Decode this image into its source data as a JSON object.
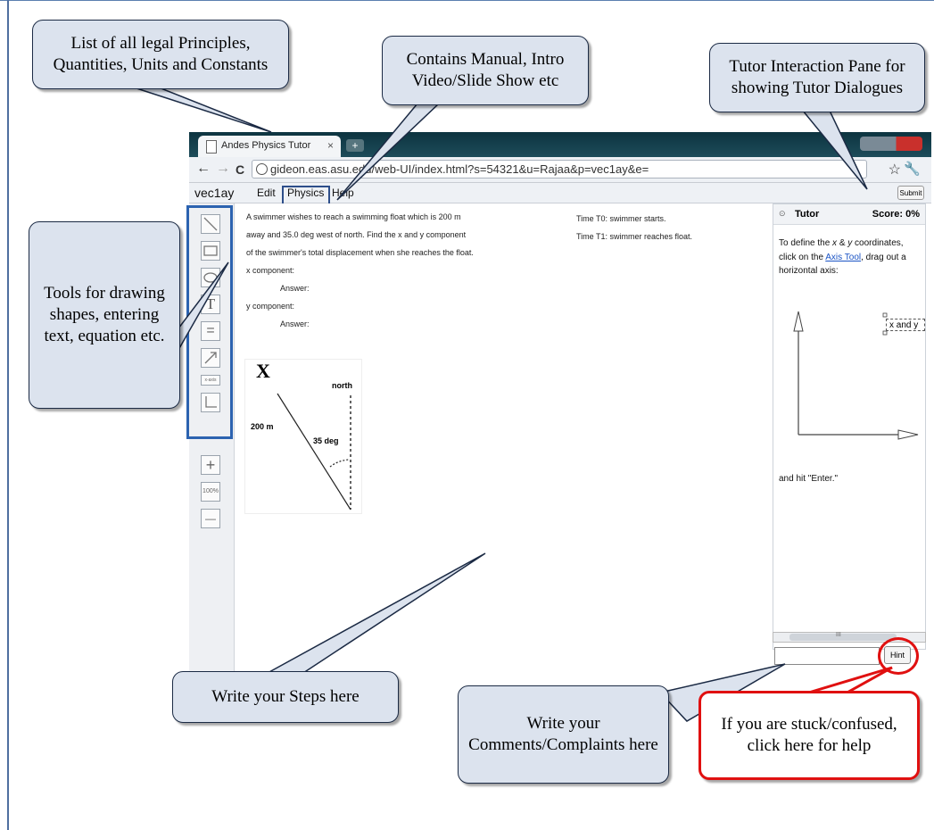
{
  "callouts": {
    "principles": "List of all legal Principles, Quantities, Units and Constants",
    "manual": "Contains Manual, Intro Video/Slide Show etc",
    "tutor_pane": "Tutor Interaction Pane for showing Tutor Dialogues",
    "tools": "Tools for drawing shapes, entering text, equation etc.",
    "steps": "Write your Steps here",
    "comments": "Write your Comments/Complaints here",
    "hint": "If you are stuck/confused, click here for help"
  },
  "browser": {
    "tab_title": "Andes Physics Tutor",
    "tab_close": "×",
    "new_tab": "+",
    "url": "gideon.eas.asu.edu/web-UI/index.html?s=54321&u=Rajaa&p=vec1ay&e=",
    "back_icon": "←",
    "forward_icon": "→",
    "reload_icon": "C",
    "star_icon": "☆",
    "wrench_icon": "🔧"
  },
  "menubar": {
    "problem": "vec1ay",
    "items": [
      "Edit",
      "Physics",
      "Help"
    ],
    "submit_label": "Submit"
  },
  "tools": {
    "items": [
      "line-tool",
      "rectangle-tool",
      "ellipse-tool",
      "text-tool",
      "equation-tool",
      "vector-tool",
      "axes-label-tool",
      "axes-tool"
    ],
    "text_glyph": "T",
    "equation_glyph": "=",
    "axes_label": "x-axis",
    "zoom_in": "+",
    "zoom_level": "100%",
    "zoom_out": "—"
  },
  "problem": {
    "lines": [
      "A swimmer wishes to reach a swimming float which is 200 m",
      "away and 35.0 deg west of north. Find the x and y component",
      "of the swimmer's total displacement when she reaches the float."
    ],
    "x_component": "x component:",
    "y_component": "y component:",
    "answer": "Answer:",
    "time_t0": "Time T0: swimmer starts.",
    "time_t1": "Time T1: swimmer reaches float.",
    "figure": {
      "x_mark": "X",
      "north": "north",
      "distance": "200 m",
      "angle": "35 deg"
    }
  },
  "tutor": {
    "title": "Tutor",
    "score": "Score: 0%",
    "msg_pre": "To define the ",
    "msg_x": "x",
    "msg_amp": " & ",
    "msg_y": "y",
    "msg_mid": " coordinates, click on the ",
    "link": "Axis Tool",
    "msg_post": ", drag out a horizontal axis:",
    "axis_label": "x and y",
    "enter_msg": "and hit \"Enter.\"",
    "scroll_grip": "III",
    "hint_label": "Hint"
  },
  "colors": {
    "callout_fill": "#dce3ee",
    "highlight_blue": "#2c63b0",
    "highlight_red": "#e01010",
    "link": "#1a53c4"
  }
}
